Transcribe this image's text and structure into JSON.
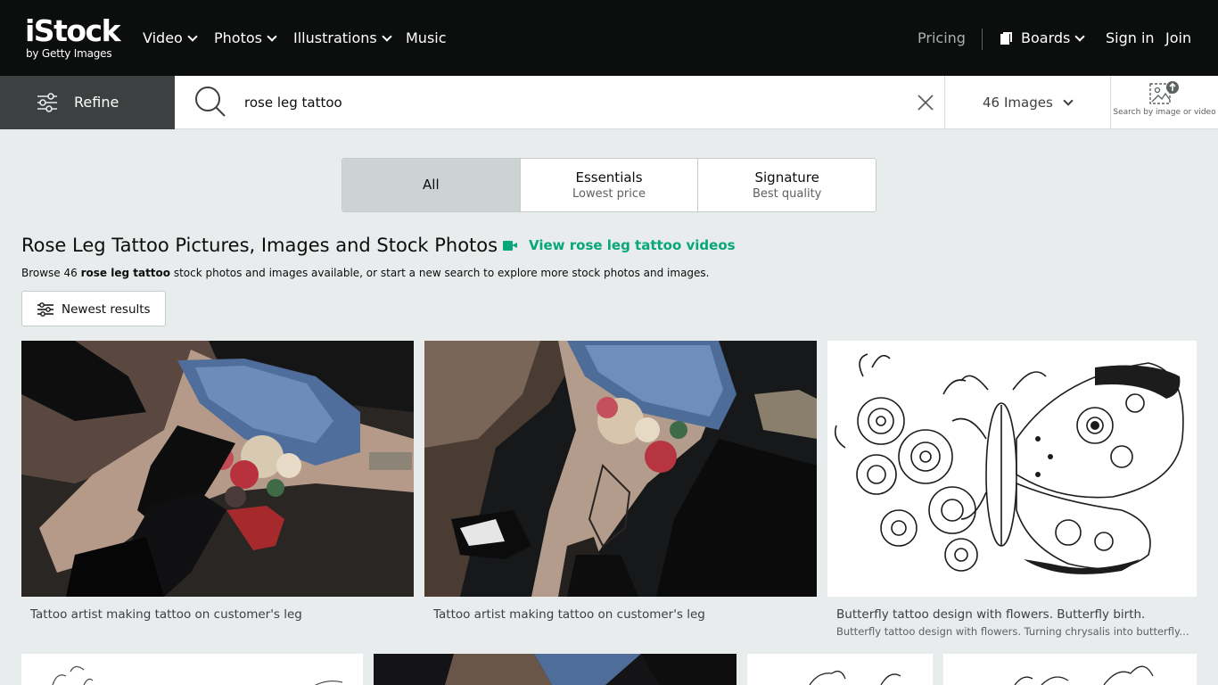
{
  "header": {
    "logo_main": "iStock",
    "logo_sub": "by Getty Images",
    "nav": [
      {
        "label": "Video"
      },
      {
        "label": "Photos"
      },
      {
        "label": "Illustrations"
      },
      {
        "label": "Music"
      }
    ],
    "pricing_label": "Pricing",
    "boards_label": "Boards",
    "signin_label": "Sign in",
    "join_label": "Join"
  },
  "search": {
    "refine_label": "Refine",
    "query": "rose leg tattoo",
    "result_count": "46",
    "media_type": "Images",
    "search_by_image_label": "Search by image or video"
  },
  "tabs": [
    {
      "title": "All",
      "subtitle": ""
    },
    {
      "title": "Essentials",
      "subtitle": "Lowest price"
    },
    {
      "title": "Signature",
      "subtitle": "Best quality"
    }
  ],
  "heading": {
    "title": "Rose Leg Tattoo Pictures, Images and Stock Photos",
    "video_link": "View rose leg tattoo videos",
    "browse_prefix": "Browse 46 ",
    "browse_term": "rose leg tattoo",
    "browse_suffix": " stock photos and images available, or start a new search to explore more stock photos and images."
  },
  "sort": {
    "label": "Newest results"
  },
  "results": [
    {
      "caption": "Tattoo artist making tattoo on customer's leg",
      "description": ""
    },
    {
      "caption": "Tattoo artist making tattoo on customer's leg",
      "description": ""
    },
    {
      "caption": "Butterfly tattoo design with flowers. Butterfly birth.",
      "description": "Butterfly tattoo design with flowers. Turning chrysalis into butterfly...."
    }
  ],
  "colors": {
    "header_bg": "#0c0d0d",
    "accent_green": "#08a77a",
    "page_bg": "#e8ecec",
    "refine_bg": "#3d4040"
  }
}
